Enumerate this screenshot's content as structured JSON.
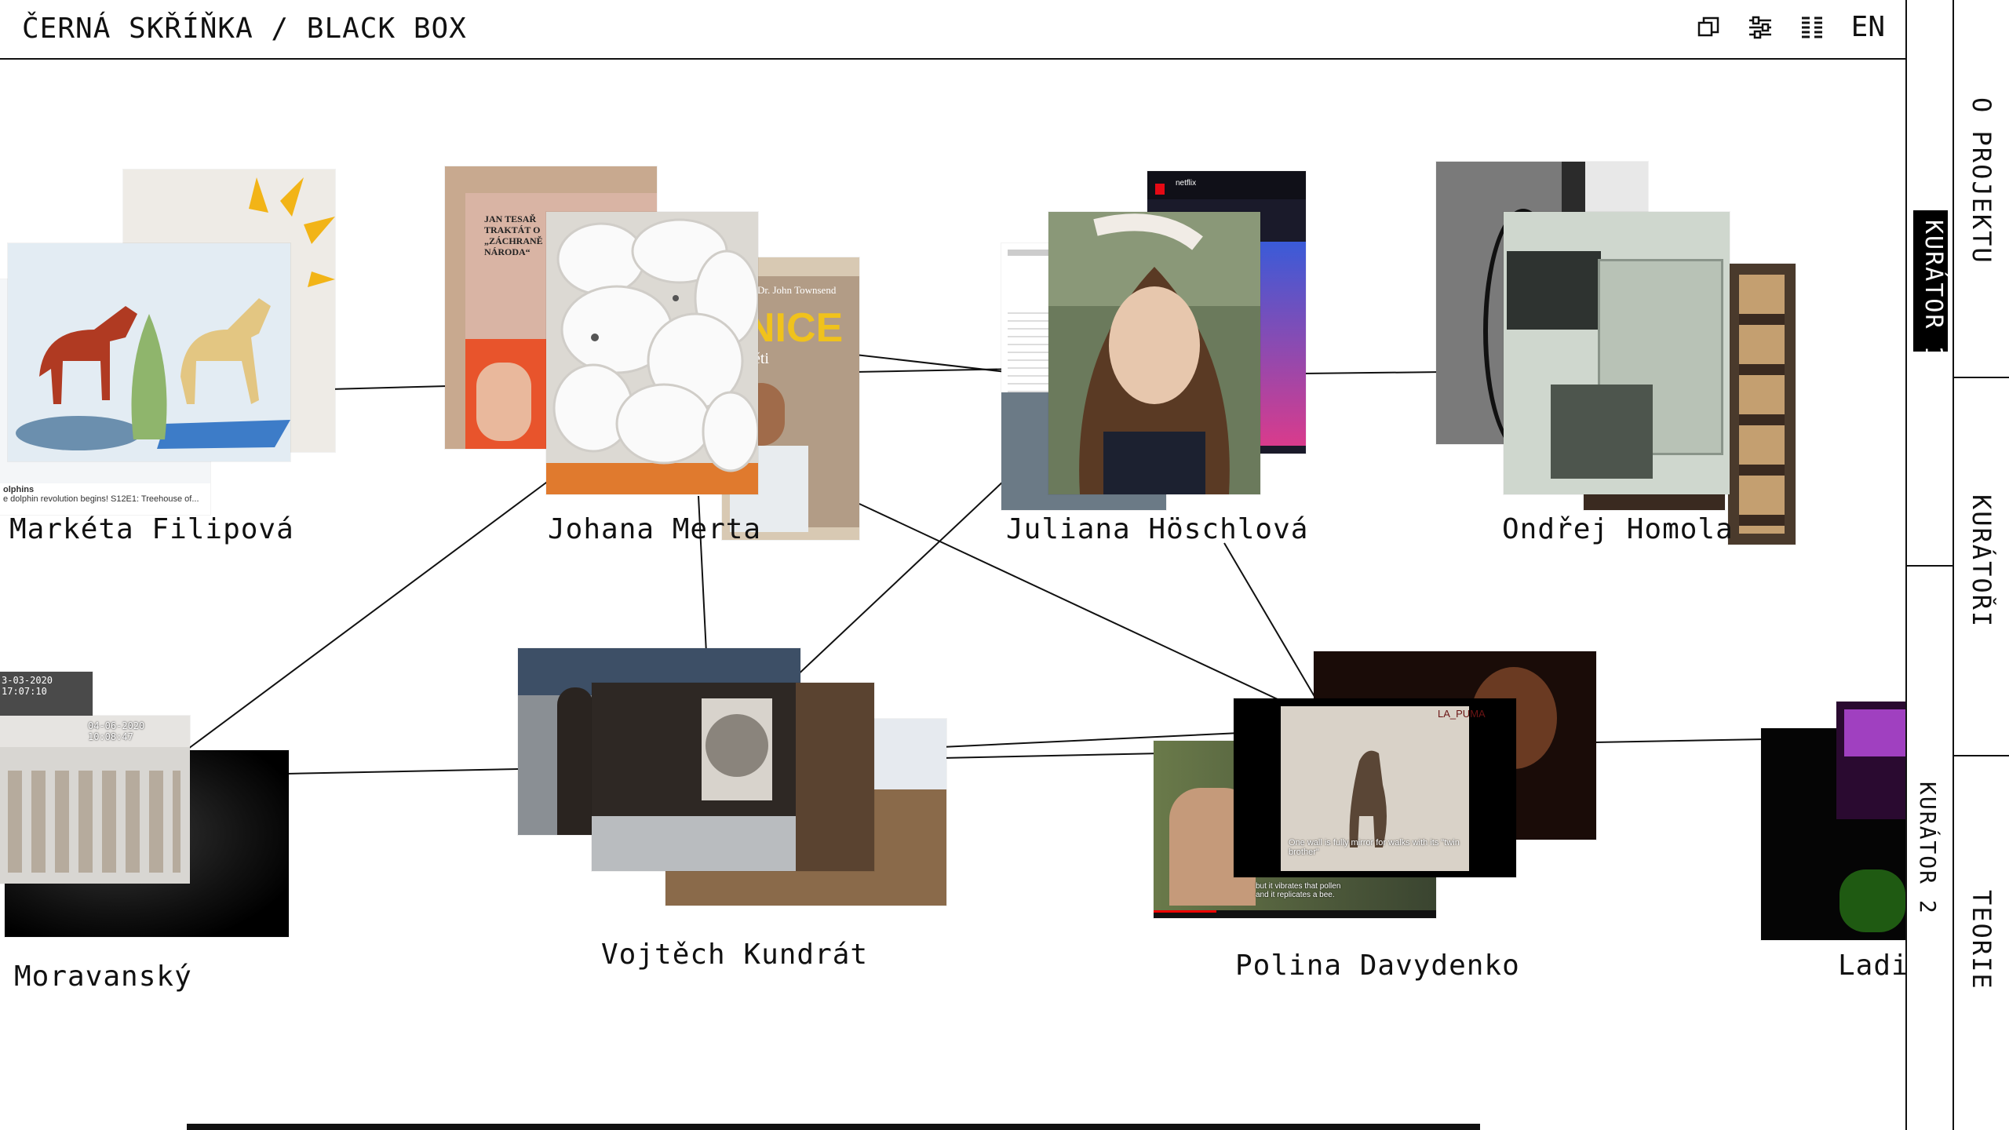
{
  "site": {
    "title": "ČERNÁ SKŘÍŇKA / BLACK BOX"
  },
  "toolbar": {
    "icons": [
      "windows-icon",
      "sliders-icon",
      "columns-icon"
    ],
    "language": "EN"
  },
  "rail": {
    "outer": [
      "O PROJEKTU",
      "KURÁTOŘI",
      "TEORIE"
    ],
    "inner": [
      "KURÁTOR 1",
      "KURÁTOR 2"
    ]
  },
  "artists": [
    {
      "name": "Markéta Filipová"
    },
    {
      "name": "Johana Merta"
    },
    {
      "name": "Juliana Höschlová"
    },
    {
      "name": "Ondřej Homola"
    },
    {
      "name": "Moravanský"
    },
    {
      "name": "Vojtěch Kundrát"
    },
    {
      "name": "Polina Davydenko"
    },
    {
      "name": "Ladi"
    }
  ],
  "thumb_text": {
    "johana_book_author": "JAN TESAŘ",
    "johana_book_title": "TRAKTÁT O „ZÁCHRANĚ NÁRODA“",
    "johana_book2_author": "Dr. John Townsend",
    "johana_book2_big": "NICE",
    "johana_book2_sub": "děti",
    "juliana_story": "netflix",
    "moravansky_ts1": "3-03-2020 17:07:10",
    "moravansky_ts2": "04-06-2020 10:08:47",
    "marketa_caption_1": "olphins",
    "marketa_caption_2": "e dolphin revolution begins! S12E1: Treehouse of...",
    "polina_caption": "One wall is fully mirror for walks with its \"twin brother\"",
    "polina_tag": "LA_PUMA",
    "polina_sub": "but it vibrates that pollen and it replicates a bee."
  },
  "colors": {
    "ink": "#111111",
    "background": "#ffffff"
  }
}
